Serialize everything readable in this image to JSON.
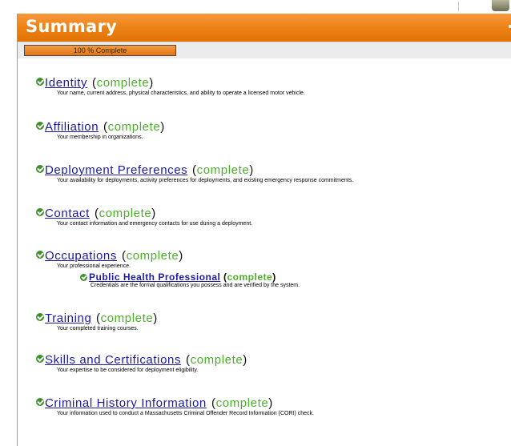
{
  "header": {
    "title": "Summary"
  },
  "progress": {
    "label": "100 % Complete",
    "fraction": 1.0
  },
  "colors": {
    "header_orange": "#ea7f12",
    "link_blue": "#1a1aa6",
    "complete_green": "#4caf2b",
    "check_green": "#3f8f2b"
  },
  "sections": [
    {
      "title": "Identity",
      "status": "complete",
      "description": "Your name, current address, physical characteristics, and ability to operate a licensed motor vehicle."
    },
    {
      "title": "Affiliation",
      "status": "complete",
      "description": "Your membership in organizations."
    },
    {
      "title": "Deployment Preferences",
      "status": "complete",
      "description": "Your availability for deployments, activity preferences for deployments, and existing emergency response commitments."
    },
    {
      "title": "Contact",
      "status": "complete",
      "description": "Your contact information and emergency contacts for use during a deployment."
    },
    {
      "title": "Occupations",
      "status": "complete",
      "description": "Your professional experience.",
      "sub": {
        "title": "Public Health Professional",
        "status": "complete",
        "description": "Credentials are the formal qualifications you possess and are verified by the system."
      }
    },
    {
      "title": "Training",
      "status": "complete",
      "description": "Your completed training courses."
    },
    {
      "title": "Skills and Certifications",
      "status": "complete",
      "description": "Your expertise to be considered for deployment eligibility."
    },
    {
      "title": "Criminal History Information",
      "status": "complete",
      "description": "Your information used to conduct a Massachusetts Criminal Offender Record Information (CORI) check."
    }
  ]
}
